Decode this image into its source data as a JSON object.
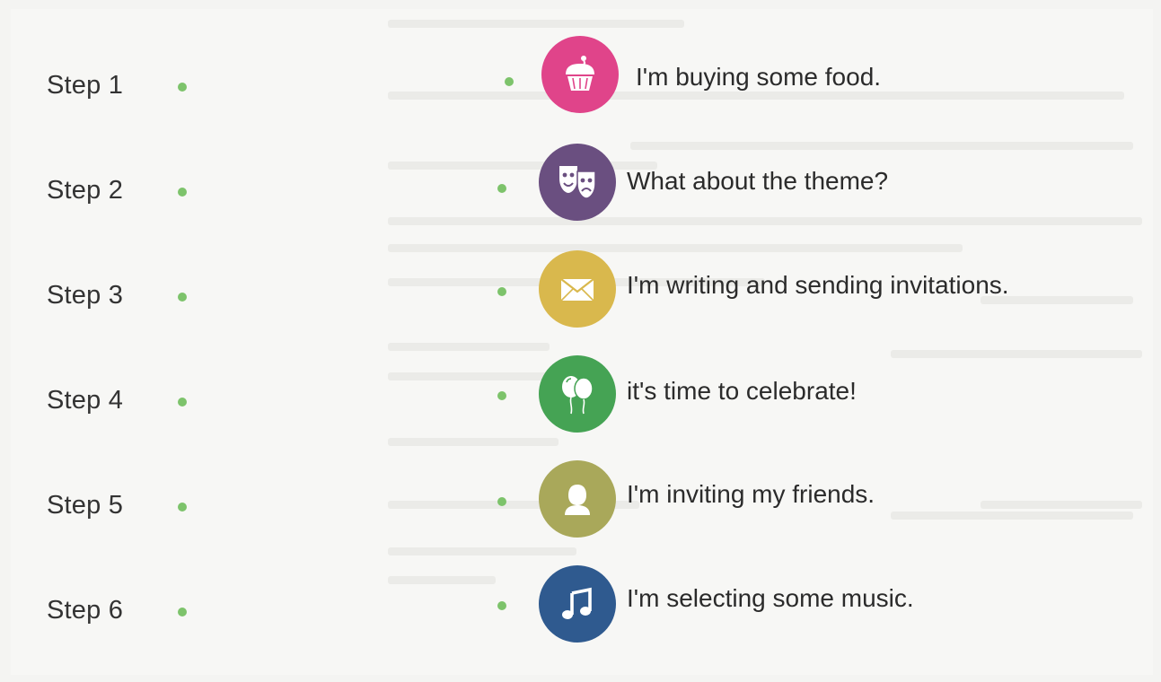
{
  "steps": [
    {
      "label": "Step 1",
      "sentence": "I'm buying some food.",
      "icon": "cupcake-icon",
      "color": "#e0448a"
    },
    {
      "label": "Step 2",
      "sentence": "What about the theme?",
      "icon": "theater-masks-icon",
      "color": "#6a4f80"
    },
    {
      "label": "Step 3",
      "sentence": "I'm writing and sending invitations.",
      "icon": "envelope-icon",
      "color": "#d9b84d"
    },
    {
      "label": "Step 4",
      "sentence": "it's time to celebrate!",
      "icon": "balloons-icon",
      "color": "#45a354"
    },
    {
      "label": "Step 5",
      "sentence": "I'm inviting my friends.",
      "icon": "person-icon",
      "color": "#a9a85a"
    },
    {
      "label": "Step 6",
      "sentence": "I'm selecting some music.",
      "icon": "music-note-icon",
      "color": "#2f5a8f"
    }
  ],
  "dot_color": "#7dc36b"
}
